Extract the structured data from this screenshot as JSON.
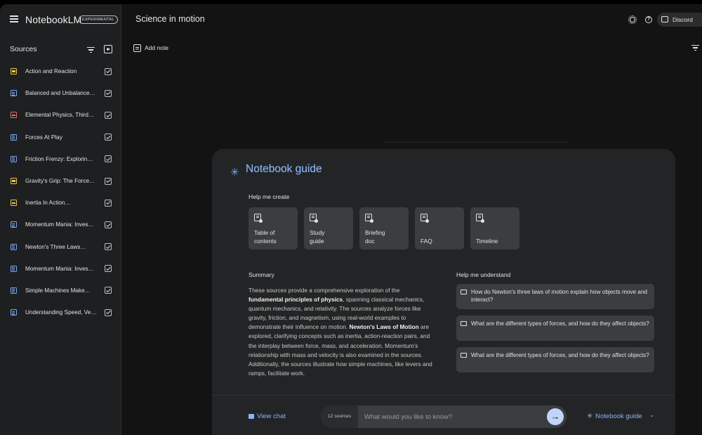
{
  "app": {
    "brand": "NotebookLM",
    "badge": "EXPERIMENTAL",
    "notebook_title": "Science in motion",
    "discord_label": "Discord"
  },
  "sidebar": {
    "title": "Sources",
    "items": [
      {
        "label": "Action and Reaction",
        "icon": "yellow-source-icon"
      },
      {
        "label": "Balanced and Unbalance…",
        "icon": "doc-icon"
      },
      {
        "label": "Elemental Physics, Third…",
        "icon": "pdf-icon"
      },
      {
        "label": "Forces At Play",
        "icon": "doc-icon"
      },
      {
        "label": "Friction Frenzy: Explorin…",
        "icon": "doc-icon"
      },
      {
        "label": "Gravity's Grip: The Force…",
        "icon": "yellow-source-icon"
      },
      {
        "label": "Inertia In Action…",
        "icon": "yellow-source-icon"
      },
      {
        "label": "Momentum Mania: Inves…",
        "icon": "doc-icon"
      },
      {
        "label": "Newton's Three Laws…",
        "icon": "doc-icon"
      },
      {
        "label": "Momentum Mania: Inves…",
        "icon": "doc-icon"
      },
      {
        "label": "Simple Machines Make…",
        "icon": "doc-icon"
      },
      {
        "label": "Understanding Speed, Ve…",
        "icon": "doc-icon"
      }
    ]
  },
  "notes": {
    "add_note_label": "Add note"
  },
  "guide": {
    "title": "Notebook guide",
    "help_create_title": "Help me create",
    "tiles": [
      {
        "label": "Table of\ncontents"
      },
      {
        "label": "Study\nguide"
      },
      {
        "label": "Briefing\ndoc"
      },
      {
        "label": "FAQ"
      },
      {
        "label": "Timeline"
      }
    ],
    "summary_title": "Summary",
    "summary": {
      "p1": "These sources provide a comprehensive exploration of the ",
      "b1": "fundamental principles of physics",
      "p2": ", spanning classical mechanics, quantum mechanics, and relativity. The sources analyze forces like gravity, friction, and magnetism, using real-world examples to demonstrate their influence on motion. ",
      "b2": "Newton's Laws of Motion",
      "p3": " are explored, clarifying concepts such as inertia, action-reaction pairs, and the interplay between force, mass, and acceleration. Momentum's relationship with mass and velocity is also examined in the sources. Additionally, the sources illustrate how simple machines, like levers and ramps, facilitate work."
    },
    "help_understand_title": "Help me understand",
    "questions": [
      "How do Newton's three laws of motion explain how objects move and interact?",
      "What are the different types of forces, and how do they affect objects?",
      "What are the different types of forces, and how do they affect objects?"
    ]
  },
  "chat": {
    "view_chat_label": "View chat",
    "sources_count": "12 sources",
    "placeholder": "What would you like to know?",
    "guide_button_label": "Notebook guide"
  },
  "colors": {
    "accent": "#8ab4f8",
    "background": "#131313",
    "sidebar": "#1e1f20",
    "card": "#232425",
    "tile": "#3b3d40"
  }
}
